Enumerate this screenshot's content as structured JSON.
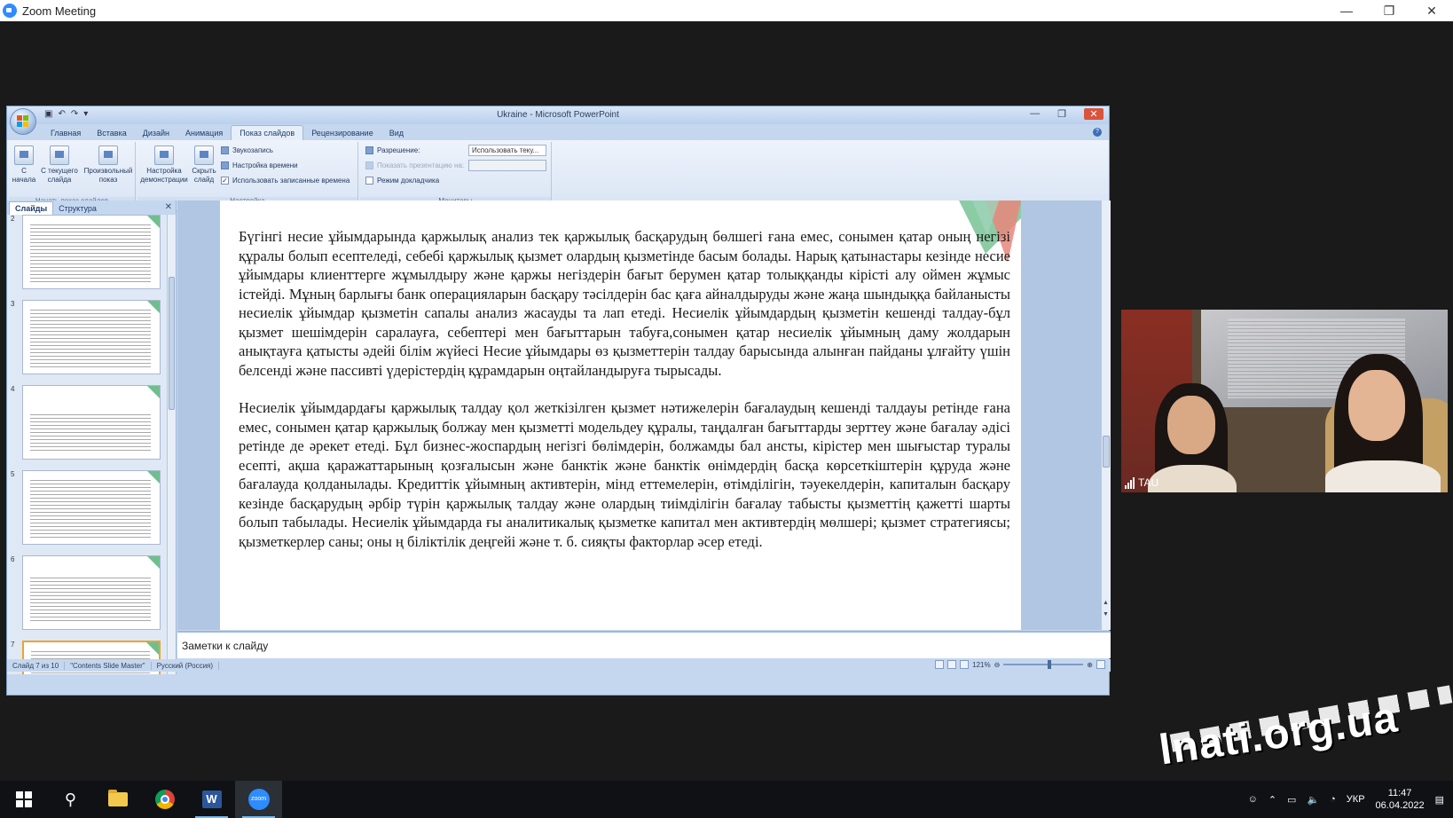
{
  "zoom": {
    "window_title": "Zoom Meeting",
    "controls": {
      "minimize": "—",
      "restore": "❐",
      "close": "✕"
    }
  },
  "ppt": {
    "window_title": "Ukraine - Microsoft PowerPoint",
    "tabs": [
      "Главная",
      "Вставка",
      "Дизайн",
      "Анимация",
      "Показ слайдов",
      "Рецензирование",
      "Вид"
    ],
    "active_tab_index": 4,
    "ribbon": {
      "group_start": {
        "label": "Начать показ слайдов",
        "btn_from_start": "С начала",
        "btn_from_current": "С текущего слайда",
        "btn_custom": "Произвольный показ"
      },
      "group_setup": {
        "label": "Настройка",
        "btn_setup": "Настройка демонстрации",
        "btn_hide": "Скрыть слайд",
        "record": "Звукозапись",
        "timing": "Настройка времени",
        "use_timings": "Использовать записанные времена",
        "use_timings_checked": "✓"
      },
      "group_monitors": {
        "label": "Мониторы",
        "resolution_label": "Разрешение:",
        "resolution_value": "Использовать теку...",
        "show_on_label": "Показать презентацию на:",
        "presenter_view": "Режим докладчика"
      }
    },
    "pane": {
      "tab_slides": "Слайды",
      "tab_outline": "Структура",
      "close": "✕",
      "slide_numbers": [
        "2",
        "3",
        "4",
        "5",
        "6",
        "7"
      ]
    },
    "slide": {
      "paragraphs": [
        "Бүгінгі несие ұйымдарында қаржылық анализ тек қаржылық басқарудың бөлшегі ғана емес, сонымен қатар оның негізі құралы болып есептеледі, себебі қаржылық қызмет олардың қызметінде басым болады. Нарық қатынастары кезінде несие ұйымдары клиенттерге жұмылдыру және қаржы негіздерін бағыт берумен қатар толыққанды кірісті алу оймен жұмыс істейді. Мұның барлығы банк операцияларын басқару тәсілдерін бас қаға айналдыруды және жаңа шындыққа байланысты несиелік ұйымдар қызметін сапалы анализ жасауды та лап етеді. Несиелік ұйымдардың қызметін кешенді талдау-бұл қызмет шешімдерін саралауға, себептері мен бағыттарын табуға,сонымен қатар несиелік ұйымның даму жолдарын анықтауға қатысты әдейі білім жүйесі Несие ұйымдары өз қызметтерін талдау барысында алынған пайданы ұлғайту үшін белсенді және пассивті үдерістердің құрамдарын оңтайландыруға тырысады.",
        "Несиелік ұйымдардағы қаржылық талдау қол жеткізілген қызмет нәтижелерін бағалаудың кешенді талдауы ретінде ғана емес, сонымен қатар қаржылық болжау мен қызметті модельдеу құралы, таңдалған бағыттарды зерттеу және бағалау әдісі ретінде де әрекет етеді. Бұл бизнес-жоспардың негізгі бөлімдерін, болжамды бал ансты, кірістер мен шығыстар туралы есепті, ақша қаражаттарының қозғалысын және банктік және банктік өнімдердің басқа көрсеткіштерін құруда және бағалауда қолданылады. Кредиттік ұйымның активтерін, мінд еттемелерін, өтімділігін, тәуекелдерін, капиталын басқару кезінде басқарудың әрбір түрін қаржылық талдау және олардың тиімділігін бағалау табысты қызметтің қажетті шарты болып табылады. Несиелік ұйымдарда ғы аналитикалық қызметке капитал мен активтердің мөлшері; қызмет стратегиясы; қызметкерлер саны; оны ң біліктілік деңгейі және т. б. сияқты факторлар әсер етеді."
      ]
    },
    "notes_placeholder": "Заметки к слайду",
    "status": {
      "slide": "Слайд 7 из 10",
      "theme": "\"Contents Slide Master\"",
      "lang": "Русский (Россия)",
      "zoom": "121%"
    }
  },
  "video": {
    "participant": "TAU"
  },
  "watermark": "lnati.org.ua",
  "taskbar": {
    "lang": "УКР",
    "time": "11:47",
    "date": "06.04.2022"
  },
  "colors": {
    "zoom_blue": "#2d8cff",
    "ppt_ribbon": "#c5d7ee",
    "selected_thumb": "#f0a22a"
  }
}
